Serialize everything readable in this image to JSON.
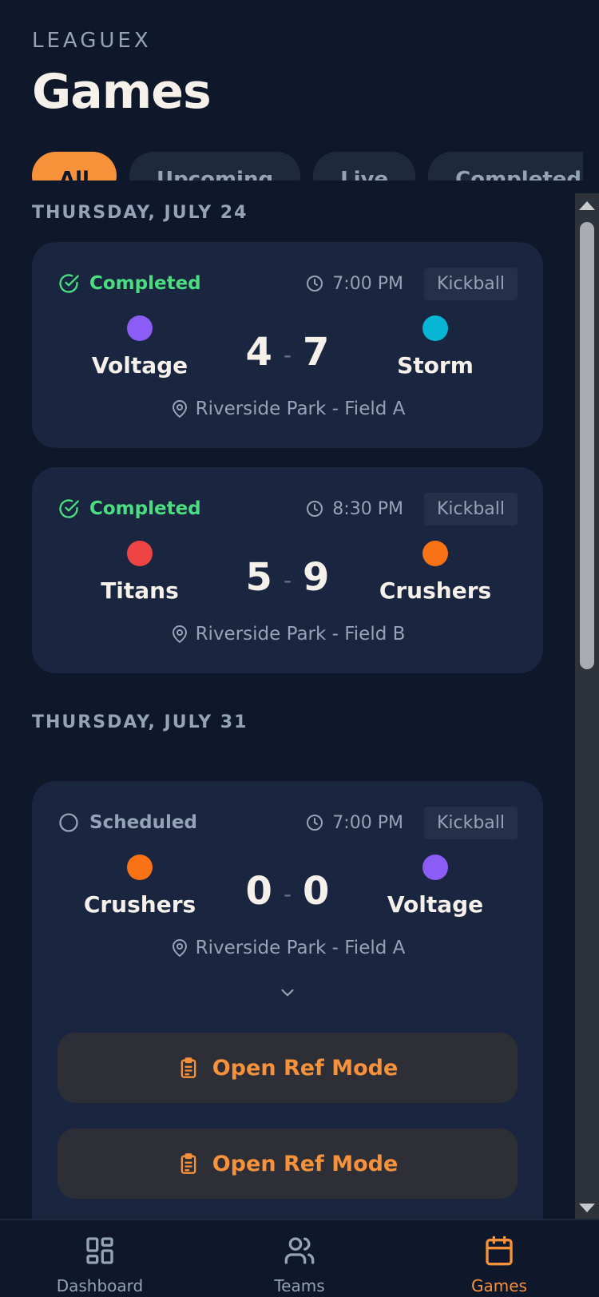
{
  "header": {
    "brand": "LEAGUEX",
    "title": "Games"
  },
  "filters": [
    {
      "label": "All",
      "active": true
    },
    {
      "label": "Upcoming",
      "active": false
    },
    {
      "label": "Live",
      "active": false
    },
    {
      "label": "Completed",
      "active": false
    }
  ],
  "groups": [
    {
      "date": "THURSDAY, JULY 24",
      "games": [
        {
          "status": "Completed",
          "time": "7:00 PM",
          "sport": "Kickball",
          "home": {
            "name": "Voltage",
            "color": "#8b5cf6",
            "score": "4"
          },
          "away": {
            "name": "Storm",
            "color": "#06b6d4",
            "score": "7"
          },
          "location": "Riverside Park - Field A"
        },
        {
          "status": "Completed",
          "time": "8:30 PM",
          "sport": "Kickball",
          "home": {
            "name": "Titans",
            "color": "#ef4444",
            "score": "5"
          },
          "away": {
            "name": "Crushers",
            "color": "#f97316",
            "score": "9"
          },
          "location": "Riverside Park - Field B"
        }
      ]
    },
    {
      "date": "THURSDAY, JULY 31",
      "games": [
        {
          "status": "Scheduled",
          "time": "7:00 PM",
          "sport": "Kickball",
          "home": {
            "name": "Crushers",
            "color": "#f97316",
            "score": "0"
          },
          "away": {
            "name": "Voltage",
            "color": "#8b5cf6",
            "score": "0"
          },
          "location": "Riverside Park - Field A",
          "actions": [
            "Open Ref Mode",
            "Open Ref Mode"
          ]
        }
      ]
    }
  ],
  "score_separator": "-",
  "nav": [
    {
      "label": "Dashboard",
      "icon": "dashboard-icon",
      "active": false
    },
    {
      "label": "Teams",
      "icon": "users-icon",
      "active": false
    },
    {
      "label": "Games",
      "icon": "calendar-icon",
      "active": true
    }
  ],
  "colors": {
    "accent": "#f7923b",
    "completed": "#4ade80",
    "background": "#0f172a",
    "card": "#1a2540"
  }
}
